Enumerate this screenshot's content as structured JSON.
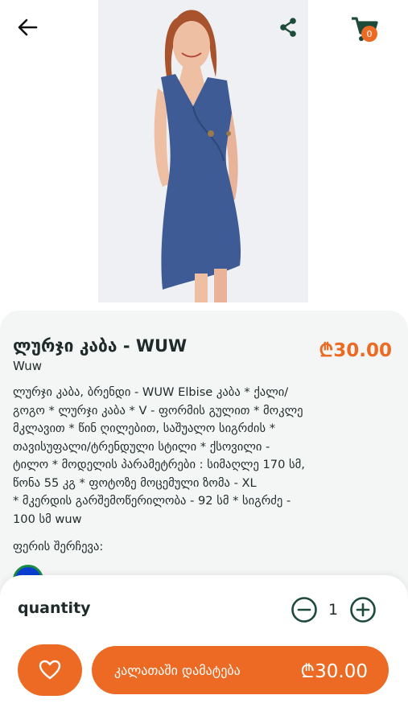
{
  "header": {
    "back_icon": "arrow-left-icon",
    "share_icon": "share-icon",
    "cart_icon": "cart-icon",
    "cart_count": "0"
  },
  "product": {
    "title": "ლურჯი კაბა - WUW",
    "brand": "Wuw",
    "price": "₾30.00",
    "description": "ლურჯი კაბა, ბრენდი - WUW Elbise კაბა * ქალი/\nგოგო * ლურჯი კაბა * V - ფორმის გულით * მოკლე\nმკლავით * წინ ღილებით, საშუალო სიგრძის *\nთავისუფალი/ტრენდული სტილი  * ქსოვილი -\nტილო  * მოდელის პარამეტრები : სიმაღლე 170 სმ,\nწონა 55 კგ * ფოტოზე მოცემული ზომა -  XL\n*  მკერდის გარშემოწერილობა - 92 სმ * სიგრძე -\n100 სმ  wuw",
    "color_label": "ფერის შერჩევა:",
    "color_swatch": "#0a3fd1"
  },
  "quantity": {
    "label": "quantity",
    "value": "1",
    "minus_icon": "minus-circle-icon",
    "plus_icon": "plus-circle-icon"
  },
  "actions": {
    "favorite_icon": "heart-icon",
    "add_label": "კალათაში დამატება",
    "add_price": "₾30.00"
  },
  "colors": {
    "accent": "#ec6a23",
    "icon_dark": "#1e4a3a",
    "text": "#1f2a2a",
    "card": "#f4f5f5"
  }
}
